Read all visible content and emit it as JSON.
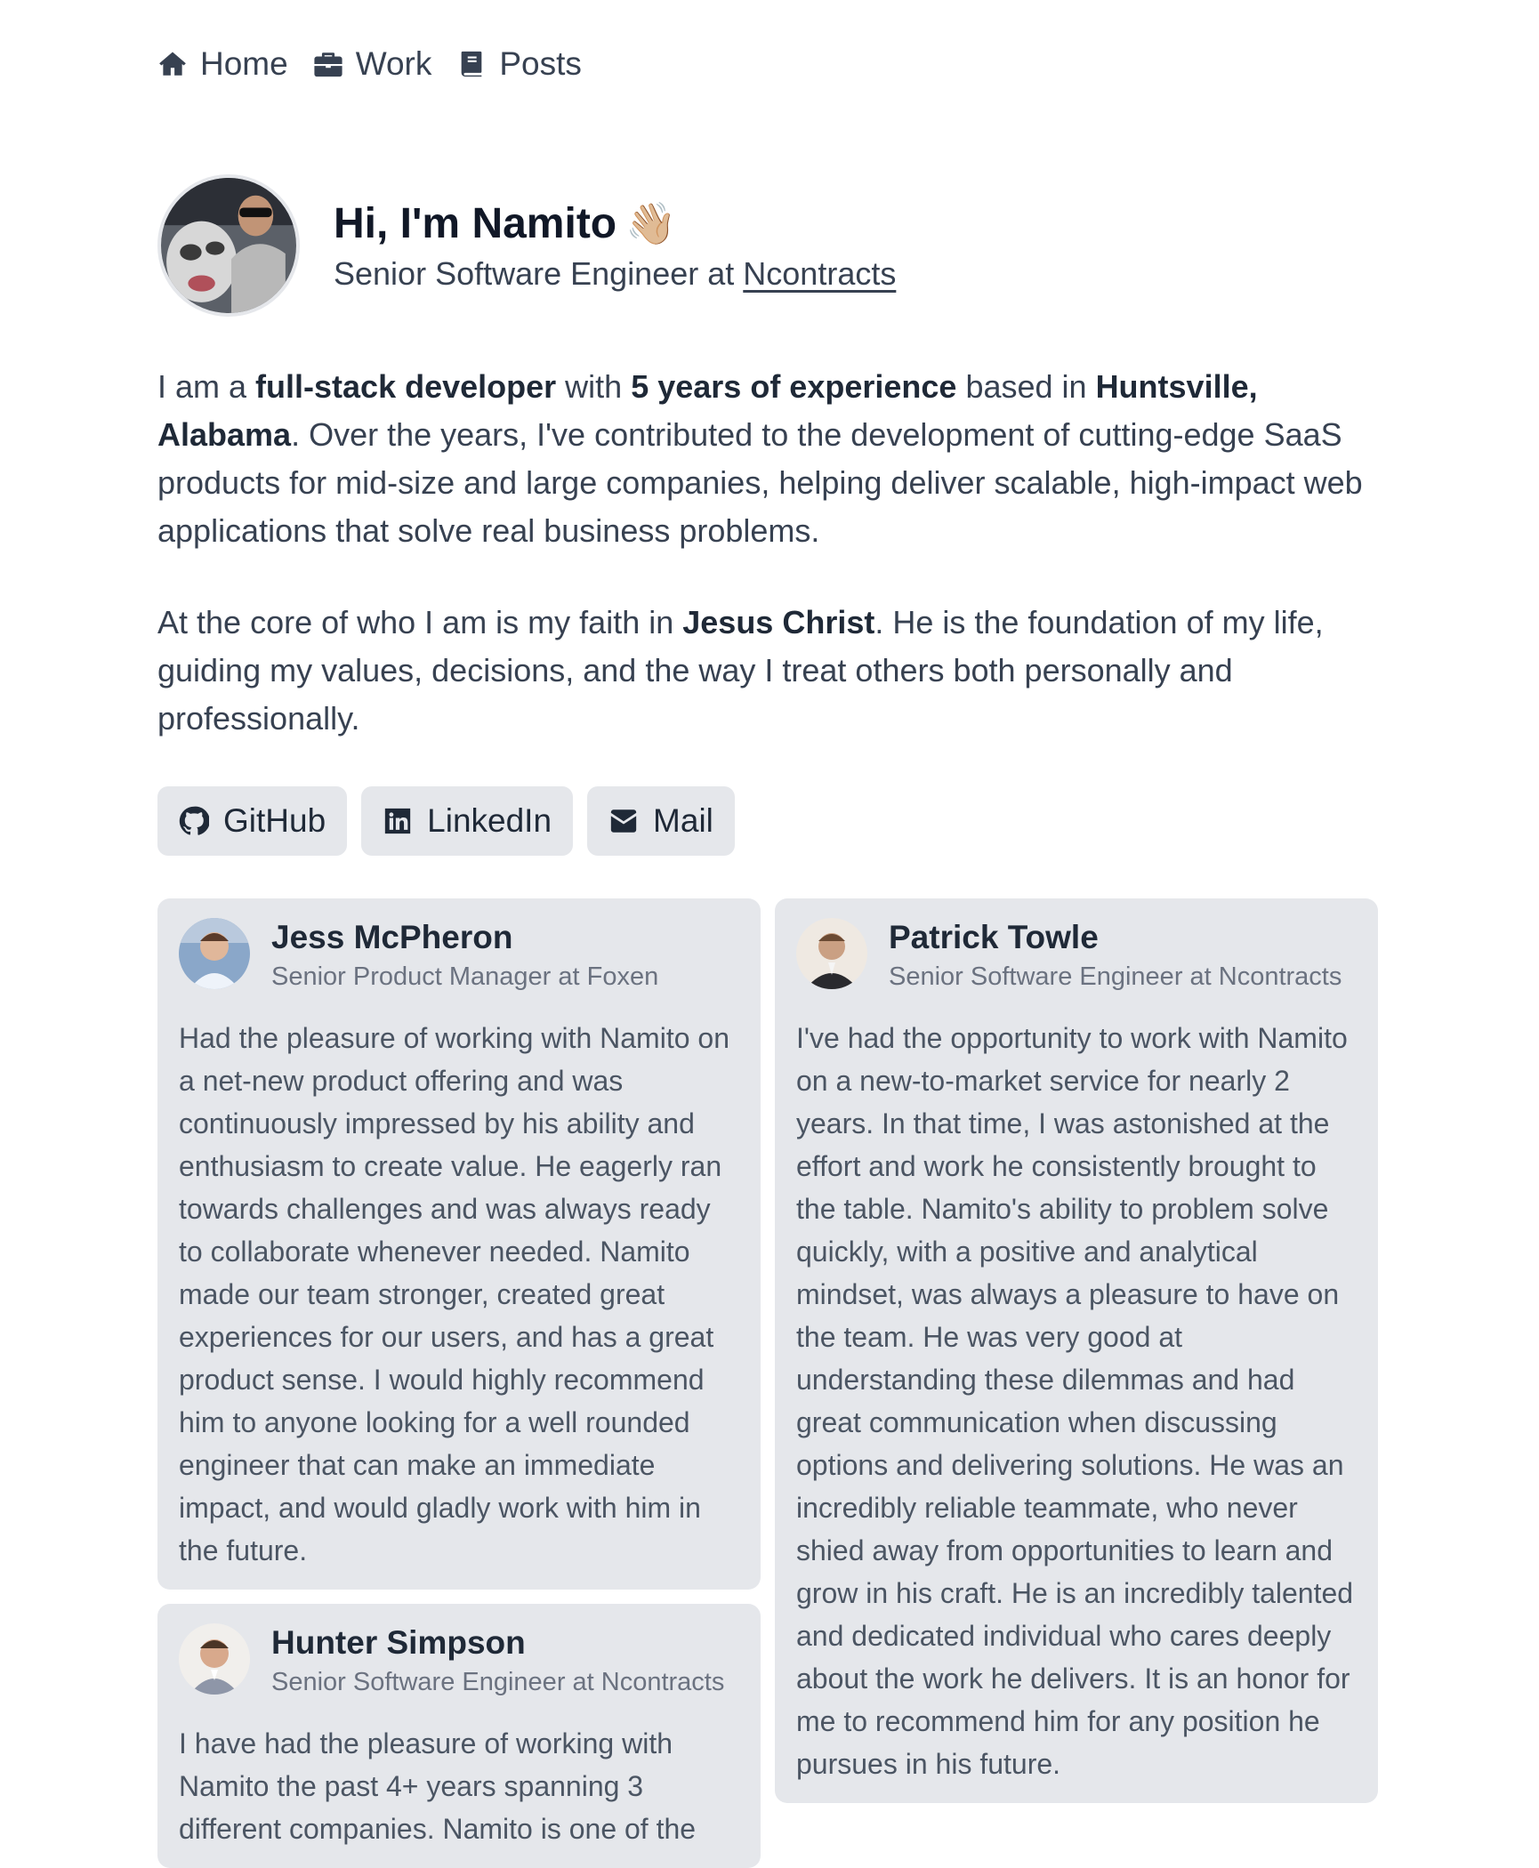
{
  "nav": [
    {
      "label": "Home",
      "icon": "home-icon"
    },
    {
      "label": "Work",
      "icon": "briefcase-icon"
    },
    {
      "label": "Posts",
      "icon": "book-icon"
    }
  ],
  "profile": {
    "greeting": "Hi, I'm Namito",
    "wave": "👋🏼",
    "role_prefix": "Senior Software Engineer at",
    "company": "Ncontracts"
  },
  "bio": {
    "p1": {
      "t1": "I am a ",
      "b1": "full-stack developer",
      "t2": " with ",
      "b2": "5 years of experience",
      "t3": " based in ",
      "b3": "Huntsville, Alabama",
      "t4": ". Over the years, I've contributed to the development of cutting-edge SaaS products for mid-size and large companies, helping deliver scalable, high-impact web applications that solve real business problems."
    },
    "p2": {
      "t1": "At the core of who I am is my faith in ",
      "b1": "Jesus Christ",
      "t2": ". He is the foundation of my life, guiding my values, decisions, and the way I treat others both personally and professionally."
    }
  },
  "social": [
    {
      "label": "GitHub",
      "icon": "github-icon"
    },
    {
      "label": "LinkedIn",
      "icon": "linkedin-icon"
    },
    {
      "label": "Mail",
      "icon": "mail-icon"
    }
  ],
  "testimonials": [
    {
      "name": "Jess McPheron",
      "title": "Senior Product Manager at Foxen",
      "text": "Had the pleasure of working with Namito on a net-new product offering and was continuously impressed by his ability and enthusiasm to create value. He eagerly ran towards challenges and was always ready to collaborate whenever needed. Namito made our team stronger, created great experiences for our users, and has a great product sense. I would highly recommend him to anyone looking for a well rounded engineer that can make an immediate impact, and would gladly work with him in the future."
    },
    {
      "name": "Patrick Towle",
      "title": "Senior Software Engineer at Ncontracts",
      "text": "I've had the opportunity to work with Namito on a new-to-market service for nearly 2 years. In that time, I was astonished at the effort and work he consistently brought to the table. Namito's ability to problem solve quickly, with a positive and analytical mindset, was always a pleasure to have on the team. He was very good at understanding these dilemmas and had great communication when discussing options and delivering solutions. He was an incredibly reliable teammate, who never shied away from opportunities to learn and grow in his craft. He is an incredibly talented and dedicated individual who cares deeply about the work he delivers. It is an honor for me to recommend him for any position he pursues in his future."
    },
    {
      "name": "Hunter Simpson",
      "title": "Senior Software Engineer at Ncontracts",
      "text": "I have had the pleasure of working with Namito the past 4+ years spanning 3 different companies. Namito is one of the"
    }
  ]
}
